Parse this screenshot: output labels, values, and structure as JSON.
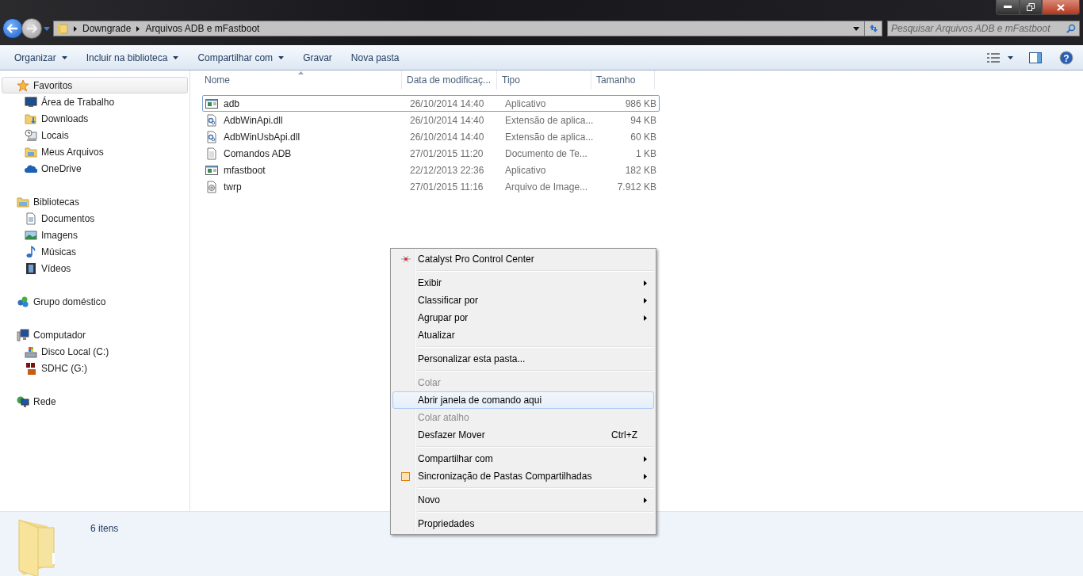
{
  "address": {
    "breadcrumbs": [
      "Downgrade",
      "Arquivos ADB e mFastboot"
    ]
  },
  "search": {
    "placeholder": "Pesquisar Arquivos ADB e mFastboot"
  },
  "toolbar": {
    "items": [
      {
        "label": "Organizar",
        "dropdown": true
      },
      {
        "label": "Incluir na biblioteca",
        "dropdown": true
      },
      {
        "label": "Compartilhar com",
        "dropdown": true
      },
      {
        "label": "Gravar",
        "dropdown": false
      },
      {
        "label": "Nova pasta",
        "dropdown": false
      }
    ],
    "help": "?"
  },
  "sidebar": {
    "groups": [
      {
        "label": "Favoritos",
        "kind": "star",
        "selected": true,
        "children": [
          {
            "label": "Área de Trabalho",
            "kind": "desktop",
            "selected": false
          },
          {
            "label": "Downloads",
            "kind": "downloads",
            "selected": false
          },
          {
            "label": "Locais",
            "kind": "places",
            "selected": false
          },
          {
            "label": "Meus Arquivos",
            "kind": "folder",
            "selected": false
          },
          {
            "label": "OneDrive",
            "kind": "cloud",
            "selected": false
          }
        ]
      },
      {
        "label": "Bibliotecas",
        "kind": "library",
        "selected": false,
        "children": [
          {
            "label": "Documentos",
            "kind": "document",
            "selected": false
          },
          {
            "label": "Imagens",
            "kind": "picture",
            "selected": false
          },
          {
            "label": "Músicas",
            "kind": "music",
            "selected": false
          },
          {
            "label": "Vídeos",
            "kind": "video",
            "selected": false
          }
        ]
      },
      {
        "label": "Grupo doméstico",
        "kind": "homegroup",
        "selected": false
      },
      {
        "label": "Computador",
        "kind": "computer",
        "selected": false,
        "children": [
          {
            "label": "Disco Local (C:)",
            "kind": "drive",
            "selected": false
          },
          {
            "label": "SDHC (G:)",
            "kind": "sd",
            "selected": false
          }
        ]
      },
      {
        "label": "Rede",
        "kind": "network",
        "selected": false
      }
    ]
  },
  "table": {
    "columns": [
      {
        "label": "Nome",
        "sorted": true
      },
      {
        "label": "Data de modificaç...",
        "sorted": false
      },
      {
        "label": "Tipo",
        "sorted": false
      },
      {
        "label": "Tamanho",
        "sorted": false
      }
    ],
    "rows": [
      {
        "kind": "app",
        "name": "adb",
        "date": "26/10/2014 14:40",
        "type": "Aplicativo",
        "size": "986 KB",
        "focused": true
      },
      {
        "kind": "dll",
        "name": "AdbWinApi.dll",
        "date": "26/10/2014 14:40",
        "type": "Extensão de aplica...",
        "size": "94 KB",
        "focused": false
      },
      {
        "kind": "dll",
        "name": "AdbWinUsbApi.dll",
        "date": "26/10/2014 14:40",
        "type": "Extensão de aplica...",
        "size": "60 KB",
        "focused": false
      },
      {
        "kind": "text",
        "name": "Comandos ADB",
        "date": "27/01/2015 11:20",
        "type": "Documento de Te...",
        "size": "1 KB",
        "focused": false
      },
      {
        "kind": "app",
        "name": "mfastboot",
        "date": "22/12/2013 22:36",
        "type": "Aplicativo",
        "size": "182 KB",
        "focused": false
      },
      {
        "kind": "image",
        "name": "twrp",
        "date": "27/01/2015 11:16",
        "type": "Arquivo de Image...",
        "size": "7.912 KB",
        "focused": false
      }
    ]
  },
  "context_menu": {
    "items": [
      {
        "kind": "item",
        "label": "Catalyst Pro Control Center",
        "disabled": false,
        "selected": false,
        "submenu": false
      },
      {
        "kind": "separator"
      },
      {
        "kind": "item",
        "label": "Exibir",
        "disabled": false,
        "selected": false,
        "submenu": true
      },
      {
        "kind": "item",
        "label": "Classificar por",
        "disabled": false,
        "selected": false,
        "submenu": true
      },
      {
        "kind": "item",
        "label": "Agrupar por",
        "disabled": false,
        "selected": false,
        "submenu": true
      },
      {
        "kind": "item",
        "label": "Atualizar",
        "disabled": false,
        "selected": false,
        "submenu": false
      },
      {
        "kind": "separator"
      },
      {
        "kind": "item",
        "label": "Personalizar esta pasta...",
        "disabled": false,
        "selected": false,
        "submenu": false
      },
      {
        "kind": "separator"
      },
      {
        "kind": "item",
        "label": "Colar",
        "disabled": true,
        "selected": false,
        "submenu": false
      },
      {
        "kind": "item",
        "label": "Abrir janela de comando aqui",
        "disabled": false,
        "selected": true,
        "submenu": false
      },
      {
        "kind": "item",
        "label": "Colar atalho",
        "disabled": true,
        "selected": false,
        "submenu": false
      },
      {
        "kind": "item",
        "label": "Desfazer Mover",
        "shortcut": "Ctrl+Z",
        "disabled": false,
        "selected": false,
        "submenu": false
      },
      {
        "kind": "separator"
      },
      {
        "kind": "item",
        "label": "Compartilhar com",
        "disabled": false,
        "selected": false,
        "submenu": true
      },
      {
        "kind": "item",
        "label": "Sincronização de Pastas Compartilhadas",
        "disabled": false,
        "selected": false,
        "submenu": true
      },
      {
        "kind": "separator"
      },
      {
        "kind": "item",
        "label": "Novo",
        "disabled": false,
        "selected": false,
        "submenu": true
      },
      {
        "kind": "separator"
      },
      {
        "kind": "item",
        "label": "Propriedades",
        "disabled": false,
        "selected": false,
        "submenu": false
      }
    ]
  },
  "details": {
    "count": "6 itens"
  }
}
